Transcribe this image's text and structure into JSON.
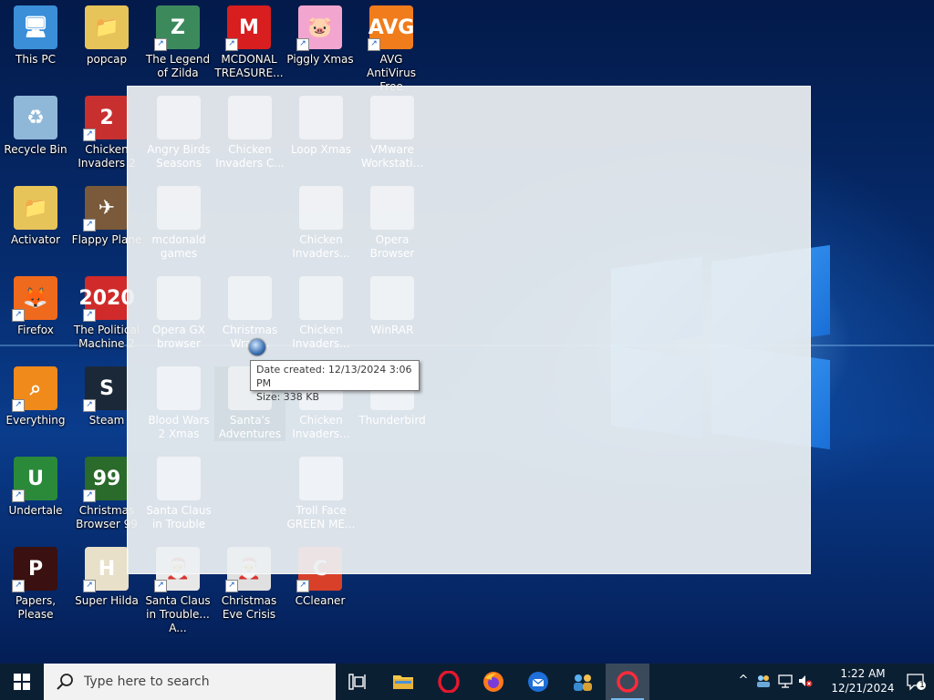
{
  "desktop": {
    "icons": [
      {
        "label": "This PC",
        "glyph": "🖥",
        "bg": "#3b8fd8",
        "icon_name": "this-pc-icon"
      },
      {
        "label": "popcap",
        "glyph": "📁",
        "bg": "#e7c45a",
        "icon_name": "folder-icon"
      },
      {
        "label": "The Legend of Zilda",
        "glyph": "Z",
        "bg": "#3c8a5c",
        "icon_name": "game-icon"
      },
      {
        "label": "MCDONAL TREASURE...",
        "glyph": "M",
        "bg": "#d81e1e",
        "icon_name": "mcdonalds-icon"
      },
      {
        "label": "Piggly Xmas",
        "glyph": "🐷",
        "bg": "#f2a6cf",
        "icon_name": "pig-icon"
      },
      {
        "label": "AVG AntiVirus Free",
        "glyph": "AVG",
        "bg": "#f07c1c",
        "icon_name": "avg-icon"
      },
      {
        "label": "Recycle Bin",
        "glyph": "♻",
        "bg": "#8fb8d8",
        "icon_name": "recycle-bin-icon"
      },
      {
        "label": "Chicken Invaders 2",
        "glyph": "2",
        "bg": "#c83030",
        "icon_name": "chicken-icon"
      },
      {
        "label": "Activator",
        "glyph": "📁",
        "bg": "#e7c45a",
        "icon_name": "folder-icon"
      },
      {
        "label": "Flappy Plane",
        "glyph": "✈",
        "bg": "#7a5a3a",
        "icon_name": "plane-icon"
      },
      {
        "label": "Firefox",
        "glyph": "🦊",
        "bg": "#f06a1e",
        "icon_name": "firefox-icon"
      },
      {
        "label": "The Political Machine 2",
        "glyph": "2020",
        "bg": "#d02a2a",
        "icon_name": "political-machine-icon"
      },
      {
        "label": "Everything",
        "glyph": "⌕",
        "bg": "#f08a1a",
        "icon_name": "search-everything-icon"
      },
      {
        "label": "Steam",
        "glyph": "S",
        "bg": "#1b2838",
        "icon_name": "steam-icon"
      },
      {
        "label": "Undertale",
        "glyph": "U",
        "bg": "#2a8a3a",
        "icon_name": "undertale-icon"
      },
      {
        "label": "Christmas Browser 99",
        "glyph": "99",
        "bg": "#2a6a2a",
        "icon_name": "christmas-tree-icon"
      },
      {
        "label": "Papers, Please",
        "glyph": "P",
        "bg": "#3a1010",
        "icon_name": "papers-please-icon"
      },
      {
        "label": "Super Hilda",
        "glyph": "H",
        "bg": "#e8e0c8",
        "icon_name": "super-hilda-icon"
      },
      {
        "label": "Santa Claus in Trouble... A...",
        "glyph": "🎅",
        "bg": "#e8e8e8",
        "icon_name": "santa-icon"
      },
      {
        "label": "Christmas Eve Crisis",
        "glyph": "🎅",
        "bg": "#e0e0e0",
        "icon_name": "christmas-eve-icon"
      },
      {
        "label": "CCleaner",
        "glyph": "C",
        "bg": "#d8402a",
        "icon_name": "ccleaner-icon"
      }
    ]
  },
  "overlay": {
    "ghost_icons": [
      {
        "label": "Angry Birds Seasons"
      },
      {
        "label": "Chicken Invaders C..."
      },
      {
        "label": "Loop Xmas"
      },
      {
        "label": "VMware Workstati..."
      },
      {
        "label": "mcdonald games"
      },
      {
        "label": "Chicken Invaders..."
      },
      {
        "label": "Opera Browser"
      },
      {
        "label": "Opera GX browser"
      },
      {
        "label": "Christmas Wrap..."
      },
      {
        "label": "Chicken Invaders..."
      },
      {
        "label": "WinRAR"
      },
      {
        "label": "Blood Wars 2 Xmas"
      },
      {
        "label": "Santa's Adventures"
      },
      {
        "label": "Chicken Invaders..."
      },
      {
        "label": "Thunderbird"
      },
      {
        "label": "Santa Claus in Trouble"
      },
      {
        "label": "Troll Face GREEN ME..."
      }
    ]
  },
  "tooltip": {
    "line1": "Date created: 12/13/2024 3:06 PM",
    "line2": "Size: 338 KB"
  },
  "taskbar": {
    "search_placeholder": "Type here to search",
    "apps": [
      {
        "name": "task-view-icon",
        "glyph": "⧉"
      },
      {
        "name": "file-explorer-icon",
        "glyph": "📁"
      },
      {
        "name": "opera-icon",
        "glyph": "O"
      },
      {
        "name": "firefox-icon",
        "glyph": "🦊"
      },
      {
        "name": "thunderbird-icon",
        "glyph": "✉"
      },
      {
        "name": "people-app-icon",
        "glyph": "👥"
      },
      {
        "name": "opera-gx-icon",
        "glyph": "O"
      }
    ],
    "clock": {
      "time": "1:22 AM",
      "date": "12/21/2024"
    },
    "notification_count": "1"
  },
  "colors": {
    "taskbar_bg": "#0b1f33",
    "accent": "#76b9ed",
    "opera_red": "#e3182d"
  }
}
